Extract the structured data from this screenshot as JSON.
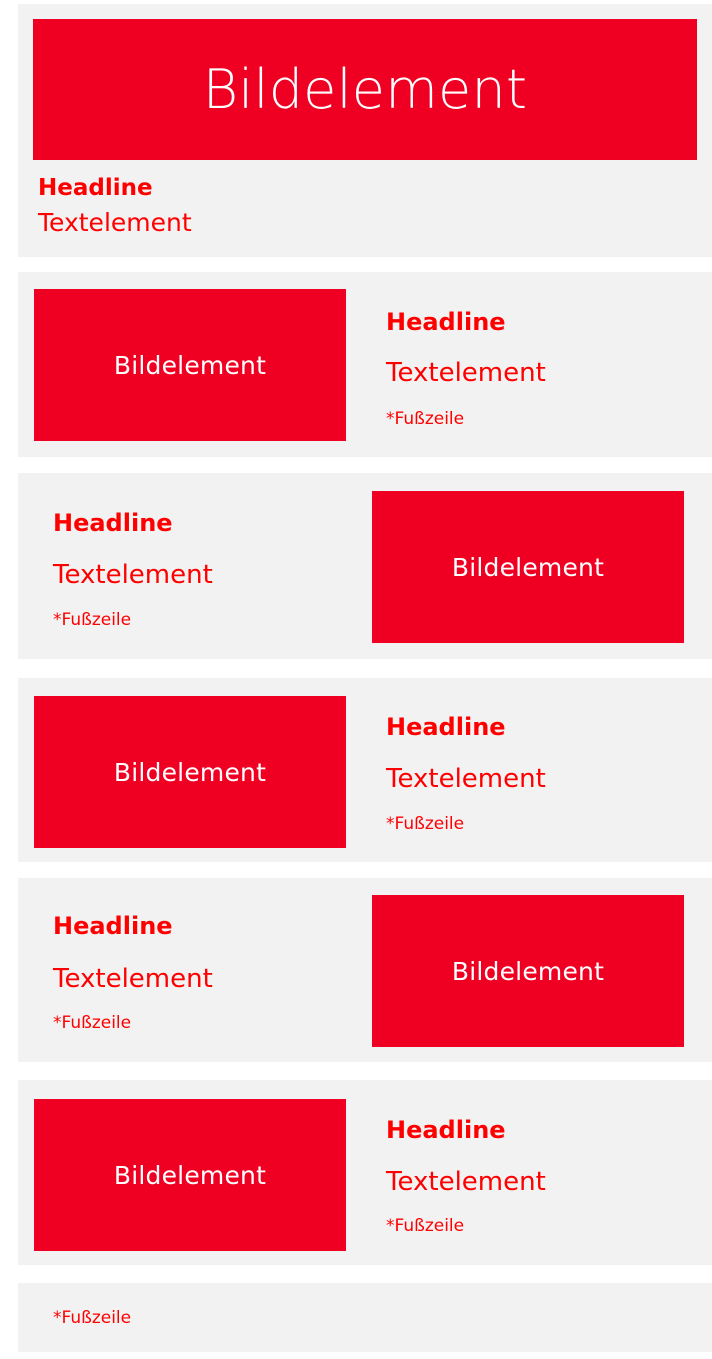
{
  "colors": {
    "accent": "#ef0022",
    "text": "#ff0000",
    "panel": "#f2f2f2"
  },
  "hero_block": {
    "image_label": "Bildelement",
    "headline": "Headline",
    "text": "Textelement"
  },
  "blocks": [
    {
      "image_label": "Bildelement",
      "headline": "Headline",
      "text": "Textelement",
      "footnote": "*Fußzeile",
      "image_side": "left"
    },
    {
      "image_label": "Bildelement",
      "headline": "Headline",
      "text": "Textelement",
      "footnote": "*Fußzeile",
      "image_side": "right"
    },
    {
      "image_label": "Bildelement",
      "headline": "Headline",
      "text": "Textelement",
      "footnote": "*Fußzeile",
      "image_side": "left"
    },
    {
      "image_label": "Bildelement",
      "headline": "Headline",
      "text": "Textelement",
      "footnote": "*Fußzeile",
      "image_side": "right"
    },
    {
      "image_label": "Bildelement",
      "headline": "Headline",
      "text": "Textelement",
      "footnote": "*Fußzeile",
      "image_side": "left"
    }
  ],
  "footer_block": {
    "footnote": "*Fußzeile"
  }
}
